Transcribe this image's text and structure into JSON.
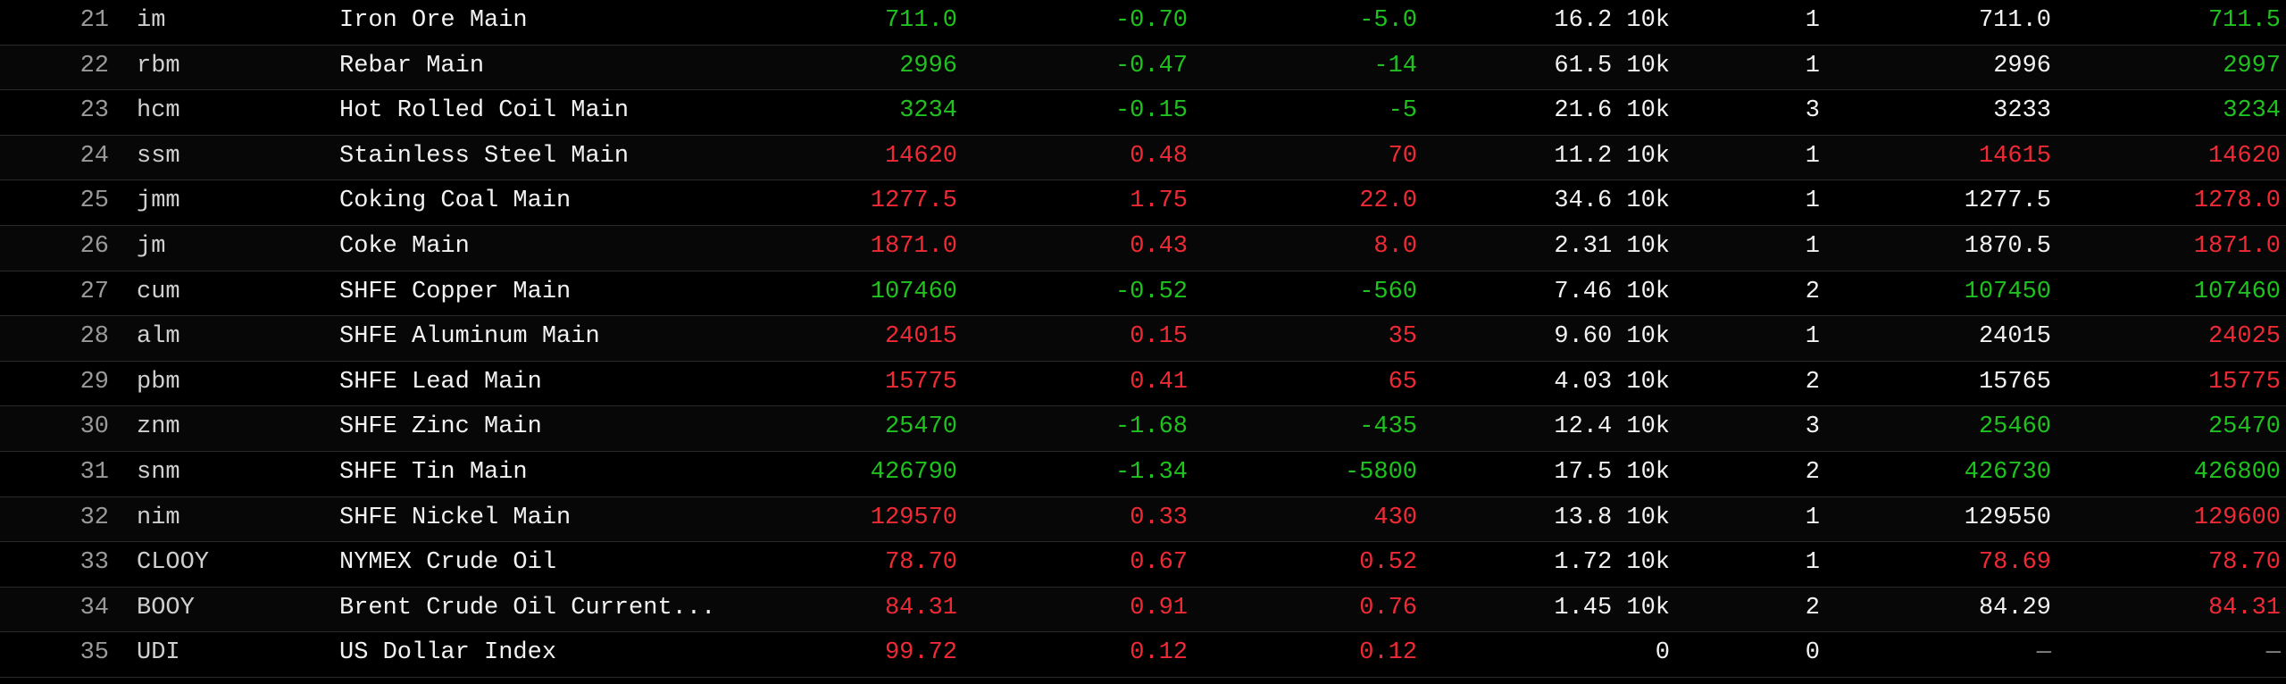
{
  "colors": {
    "background": "#000000",
    "up": "#f02a35",
    "down": "#1fc21f",
    "neutral": "#f2f2f2",
    "muted": "#9a9a9a",
    "row_divider": "#2a2a2a"
  },
  "rows": [
    {
      "idx": "21",
      "code": "im",
      "name": "Iron Ore Main",
      "last": "711.0",
      "pct": "-0.70",
      "chg": "-5.0",
      "vol": "16.2 10k",
      "qty": "1",
      "bid": "711.0",
      "ask": "711.5",
      "last_dir": "down",
      "pct_dir": "down",
      "chg_dir": "down",
      "bid_dir": "flat",
      "ask_dir": "down"
    },
    {
      "idx": "22",
      "code": "rbm",
      "name": "Rebar Main",
      "last": "2996",
      "pct": "-0.47",
      "chg": "-14",
      "vol": "61.5 10k",
      "qty": "1",
      "bid": "2996",
      "ask": "2997",
      "last_dir": "down",
      "pct_dir": "down",
      "chg_dir": "down",
      "bid_dir": "flat",
      "ask_dir": "down"
    },
    {
      "idx": "23",
      "code": "hcm",
      "name": "Hot Rolled Coil Main",
      "last": "3234",
      "pct": "-0.15",
      "chg": "-5",
      "vol": "21.6 10k",
      "qty": "3",
      "bid": "3233",
      "ask": "3234",
      "last_dir": "down",
      "pct_dir": "down",
      "chg_dir": "down",
      "bid_dir": "flat",
      "ask_dir": "down"
    },
    {
      "idx": "24",
      "code": "ssm",
      "name": "Stainless Steel Main",
      "last": "14620",
      "pct": "0.48",
      "chg": "70",
      "vol": "11.2 10k",
      "qty": "1",
      "bid": "14615",
      "ask": "14620",
      "last_dir": "up",
      "pct_dir": "up",
      "chg_dir": "up",
      "bid_dir": "up",
      "ask_dir": "up"
    },
    {
      "idx": "25",
      "code": "jmm",
      "name": "Coking Coal Main",
      "last": "1277.5",
      "pct": "1.75",
      "chg": "22.0",
      "vol": "34.6 10k",
      "qty": "1",
      "bid": "1277.5",
      "ask": "1278.0",
      "last_dir": "up",
      "pct_dir": "up",
      "chg_dir": "up",
      "bid_dir": "flat",
      "ask_dir": "up"
    },
    {
      "idx": "26",
      "code": "jm",
      "name": "Coke Main",
      "last": "1871.0",
      "pct": "0.43",
      "chg": "8.0",
      "vol": "2.31 10k",
      "qty": "1",
      "bid": "1870.5",
      "ask": "1871.0",
      "last_dir": "up",
      "pct_dir": "up",
      "chg_dir": "up",
      "bid_dir": "flat",
      "ask_dir": "up"
    },
    {
      "idx": "27",
      "code": "cum",
      "name": "SHFE Copper Main",
      "last": "107460",
      "pct": "-0.52",
      "chg": "-560",
      "vol": "7.46 10k",
      "qty": "2",
      "bid": "107450",
      "ask": "107460",
      "last_dir": "down",
      "pct_dir": "down",
      "chg_dir": "down",
      "bid_dir": "down",
      "ask_dir": "down"
    },
    {
      "idx": "28",
      "code": "alm",
      "name": "SHFE Aluminum Main",
      "last": "24015",
      "pct": "0.15",
      "chg": "35",
      "vol": "9.60 10k",
      "qty": "1",
      "bid": "24015",
      "ask": "24025",
      "last_dir": "up",
      "pct_dir": "up",
      "chg_dir": "up",
      "bid_dir": "flat",
      "ask_dir": "up"
    },
    {
      "idx": "29",
      "code": "pbm",
      "name": "SHFE Lead Main",
      "last": "15775",
      "pct": "0.41",
      "chg": "65",
      "vol": "4.03 10k",
      "qty": "2",
      "bid": "15765",
      "ask": "15775",
      "last_dir": "up",
      "pct_dir": "up",
      "chg_dir": "up",
      "bid_dir": "flat",
      "ask_dir": "up"
    },
    {
      "idx": "30",
      "code": "znm",
      "name": "SHFE Zinc Main",
      "last": "25470",
      "pct": "-1.68",
      "chg": "-435",
      "vol": "12.4 10k",
      "qty": "3",
      "bid": "25460",
      "ask": "25470",
      "last_dir": "down",
      "pct_dir": "down",
      "chg_dir": "down",
      "bid_dir": "down",
      "ask_dir": "down"
    },
    {
      "idx": "31",
      "code": "snm",
      "name": "SHFE Tin Main",
      "last": "426790",
      "pct": "-1.34",
      "chg": "-5800",
      "vol": "17.5 10k",
      "qty": "2",
      "bid": "426730",
      "ask": "426800",
      "last_dir": "down",
      "pct_dir": "down",
      "chg_dir": "down",
      "bid_dir": "down",
      "ask_dir": "down"
    },
    {
      "idx": "32",
      "code": "nim",
      "name": "SHFE Nickel Main",
      "last": "129570",
      "pct": "0.33",
      "chg": "430",
      "vol": "13.8 10k",
      "qty": "1",
      "bid": "129550",
      "ask": "129600",
      "last_dir": "up",
      "pct_dir": "up",
      "chg_dir": "up",
      "bid_dir": "flat",
      "ask_dir": "up"
    },
    {
      "idx": "33",
      "code": "CLOOY",
      "name": "NYMEX Crude Oil",
      "last": "78.70",
      "pct": "0.67",
      "chg": "0.52",
      "vol": "1.72 10k",
      "qty": "1",
      "bid": "78.69",
      "ask": "78.70",
      "last_dir": "up",
      "pct_dir": "up",
      "chg_dir": "up",
      "bid_dir": "up",
      "ask_dir": "up"
    },
    {
      "idx": "34",
      "code": "BOOY",
      "name": "Brent Crude Oil Current...",
      "last": "84.31",
      "pct": "0.91",
      "chg": "0.76",
      "vol": "1.45 10k",
      "qty": "2",
      "bid": "84.29",
      "ask": "84.31",
      "last_dir": "up",
      "pct_dir": "up",
      "chg_dir": "up",
      "bid_dir": "flat",
      "ask_dir": "up"
    },
    {
      "idx": "35",
      "code": "UDI",
      "name": "US Dollar Index",
      "last": "99.72",
      "pct": "0.12",
      "chg": "0.12",
      "vol": "0",
      "qty": "0",
      "bid": "—",
      "ask": "—",
      "last_dir": "up",
      "pct_dir": "up",
      "chg_dir": "up",
      "bid_dir": "dash",
      "ask_dir": "dash"
    }
  ]
}
